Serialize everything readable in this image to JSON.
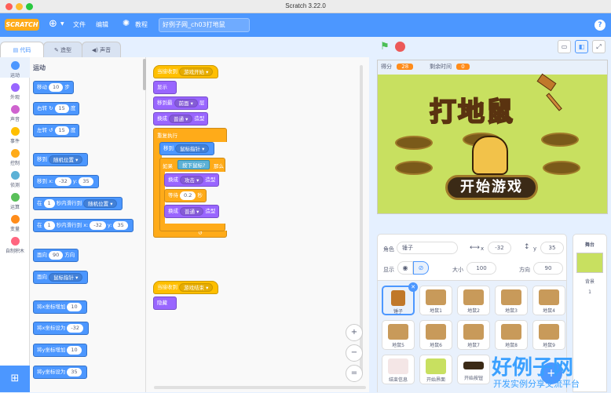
{
  "window": {
    "title": "Scratch 3.22.0"
  },
  "menu": {
    "logo": "SCRATCH",
    "file": "文件",
    "edit": "编辑",
    "tutorials": "教程",
    "project_title": "好例子网_ch03打地鼠",
    "help": "?"
  },
  "tabs": {
    "code": "代码",
    "costumes": "造型",
    "sounds": "声音"
  },
  "categories": [
    {
      "label": "运动",
      "color": "#4c97ff"
    },
    {
      "label": "外观",
      "color": "#9966ff"
    },
    {
      "label": "声音",
      "color": "#cf63cf"
    },
    {
      "label": "事件",
      "color": "#ffbf00"
    },
    {
      "label": "控制",
      "color": "#ffab19"
    },
    {
      "label": "侦测",
      "color": "#5cb1d6"
    },
    {
      "label": "运算",
      "color": "#59c059"
    },
    {
      "label": "变量",
      "color": "#ff8c1a"
    },
    {
      "label": "自制积木",
      "color": "#ff6680"
    }
  ],
  "palette": {
    "section": "运动",
    "move": {
      "a": "移动",
      "v": "10",
      "b": "步"
    },
    "turn_right": {
      "a": "右转",
      "v": "15",
      "b": "度"
    },
    "turn_left": {
      "a": "左转",
      "v": "15",
      "b": "度"
    },
    "goto_random": {
      "a": "移到",
      "d": "随机位置"
    },
    "goto_xy": {
      "a": "移到 x:",
      "x": "-32",
      "b": "y:",
      "y": "35"
    },
    "glide_random": {
      "a": "在",
      "v": "1",
      "b": "秒内滑行到",
      "d": "随机位置"
    },
    "glide_xy": {
      "a": "在",
      "v": "1",
      "b": "秒内滑行到 x:",
      "x": "-32",
      "c": "y:",
      "y": "35"
    },
    "point_dir": {
      "a": "面向",
      "v": "90",
      "b": "方向"
    },
    "point_to": {
      "a": "面向",
      "d": "鼠标指针"
    },
    "change_x": {
      "a": "将x坐标增加",
      "v": "10"
    },
    "set_x": {
      "a": "将x坐标设为",
      "v": "-32"
    },
    "change_y": {
      "a": "将y坐标增加",
      "v": "10"
    },
    "set_y": {
      "a": "将y坐标设为",
      "v": "35"
    }
  },
  "script1": {
    "hat": "当接收到",
    "hat_msg": "游戏开始",
    "show": "显示",
    "front_a": "移到最",
    "front_d": "前面",
    "front_b": "层",
    "costume_a": "换成",
    "costume_d": "普通",
    "costume_b": "造型",
    "forever": "重复执行",
    "goto_a": "移到",
    "goto_d": "鼠标指针",
    "if_a": "如果",
    "if_cond": "按下鼠标?",
    "if_b": "那么",
    "c2_a": "换成",
    "c2_d": "攻击",
    "c2_b": "造型",
    "wait_a": "等待",
    "wait_v": "0.2",
    "wait_b": "秒",
    "c3_a": "换成",
    "c3_d": "普通",
    "c3_b": "造型"
  },
  "script2": {
    "hat": "当接收到",
    "hat_msg": "游戏结束",
    "hide": "隐藏"
  },
  "zoom": {
    "in": "+",
    "out": "−",
    "reset": "="
  },
  "stage": {
    "score_label": "得分",
    "score_value": "28",
    "time_label": "剩余时间",
    "time_value": "0",
    "game_title": "打地鼠",
    "start_button": "开始游戏"
  },
  "sprite_info": {
    "sprite_label": "角色",
    "sprite_name": "锤子",
    "x_label": "x",
    "x_value": "-32",
    "y_label": "y",
    "y_value": "35",
    "show_label": "显示",
    "size_label": "大小",
    "size_value": "100",
    "dir_label": "方向",
    "dir_value": "90"
  },
  "sprites": [
    "锤子",
    "地鼠1",
    "地鼠2",
    "地鼠3",
    "地鼠4",
    "地鼠5",
    "地鼠6",
    "地鼠7",
    "地鼠8",
    "地鼠9",
    "结束信息",
    "开始界面",
    "开始按钮"
  ],
  "stage_panel": {
    "title": "舞台",
    "backdrop_label": "背景",
    "backdrop_count": "1"
  },
  "watermark": {
    "main": "好例子网",
    "sub": "开发实例分享交流平台"
  }
}
